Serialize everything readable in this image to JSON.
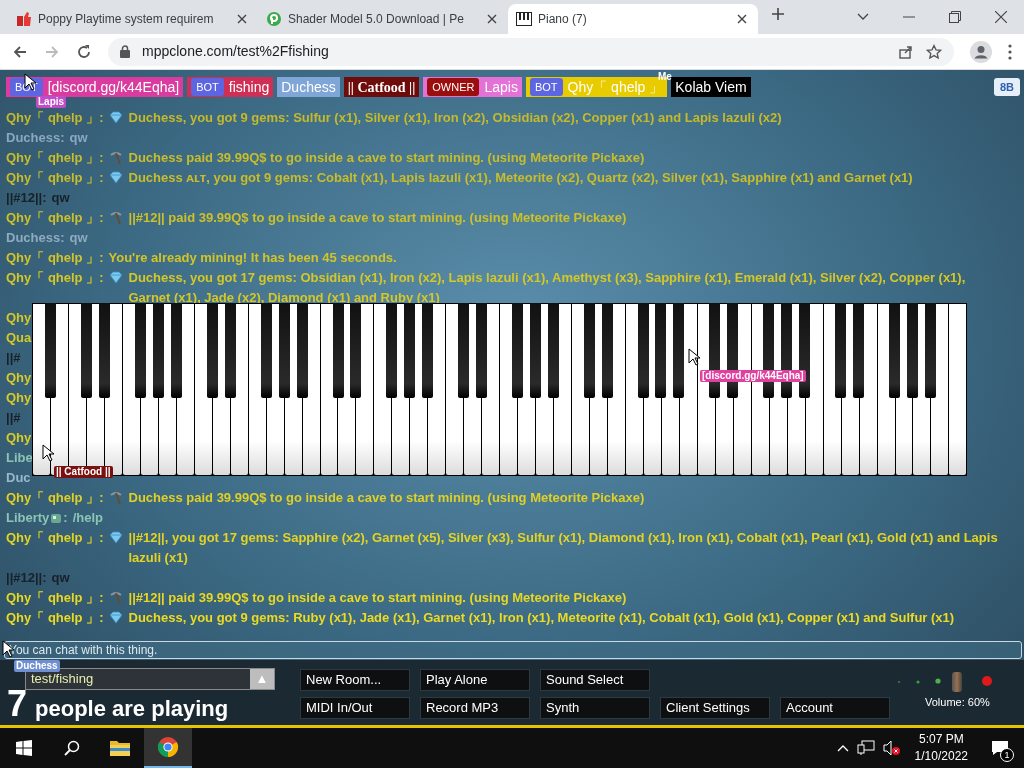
{
  "browser": {
    "tabs": [
      {
        "title": "Poppy Playtime system requirem",
        "selected": false
      },
      {
        "title": "Shader Model 5.0 Download | Pe",
        "selected": false
      },
      {
        "title": "Piano (7)",
        "selected": true
      }
    ],
    "address": "mppclone.com/test%2Ffishing"
  },
  "participants": [
    {
      "kind": "bot",
      "tag": "BOT",
      "name": "[discord.gg/k44Eqha]",
      "color": "#d93c9e"
    },
    {
      "kind": "bot",
      "tag": "BOT",
      "name": "fishing",
      "color": "#cf2f55"
    },
    {
      "kind": "plain",
      "name": "Duchess",
      "color": "#7fa6d6"
    },
    {
      "kind": "fancy",
      "name": "|| Catfood ||",
      "color": "#6e0c0c"
    },
    {
      "kind": "owner",
      "tag": "OWNER",
      "name": "Lapis",
      "color": "#e472d6"
    },
    {
      "kind": "bot",
      "tag": "BOT",
      "name": "Qhy「 qhelp 」",
      "color": "#e9cc00"
    },
    {
      "kind": "plain",
      "name": "Kolab Viem",
      "color": "#000000"
    }
  ],
  "corner_button": "8B",
  "cursors": [
    {
      "name": "Lapis",
      "color": "#c04cc8",
      "arrow": true
    },
    {
      "name": "Me",
      "arrow": false
    },
    {
      "name": "[discord.gg/k44Eqha]",
      "color": "#e040a0",
      "arrow": true
    },
    {
      "name": "|| Catfood ||",
      "color": "#7a1010",
      "arrow": true
    },
    {
      "name": "Duchess",
      "color": "#6f8fd0",
      "arrow": true
    }
  ],
  "chat": [
    {
      "kind": "gem",
      "name": "Qhy「 qhelp 」:",
      "color": "#c4ba2a",
      "text": "Duchess, you got 9 gems: Sulfur (x1), Silver (x1), Iron (x2), Obsidian (x2), Copper (x1) and Lapis lazuli (x2)"
    },
    {
      "kind": "plain",
      "name": "Duchess:",
      "color": "#8aa8be",
      "text": "qw"
    },
    {
      "kind": "pickaxe",
      "name": "Qhy「 qhelp 」:",
      "color": "#c8bd2a",
      "text": "Duchess paid 39.99Q$ to go inside a cave to start mining. (using Meteorite Pickaxe)"
    },
    {
      "kind": "gem",
      "name": "Qhy「 qhelp 」:",
      "color": "#c8bd2a",
      "text": "Duchess ᴀʟᴛ, you got 9 gems: Cobalt (x1), Lapis lazuli (x1), Meteorite (x2), Quartz (x2), Silver (x1), Sapphire (x1) and Garnet (x1)"
    },
    {
      "kind": "plain",
      "name": "||#12||:",
      "color": "#16212a",
      "text": "qw"
    },
    {
      "kind": "pickaxe",
      "name": "Qhy「 qhelp 」:",
      "color": "#cdc128",
      "text": "||#12|| paid 39.99Q$ to go inside a cave to start mining. (using Meteorite Pickaxe)"
    },
    {
      "kind": "plain",
      "name": "Duchess:",
      "color": "#8fabc0",
      "text": "qw"
    },
    {
      "kind": "plain",
      "name": "Qhy「 qhelp 」:",
      "color": "#d2c527",
      "text": "You're already mining! It has been 45 seconds."
    },
    {
      "kind": "gem",
      "name": "Qhy「 qhelp 」:",
      "color": "#d5c826",
      "text": "Duchess, you got 17 gems: Obsidian (x1), Iron (x2), Lapis lazuli (x1), Amethyst (x3), Sapphire (x1), Emerald (x1), Silver (x2), Copper (x1), Garnet (x1), Jade (x2), Diamond (x1) and Ruby (x1)"
    },
    {
      "kind": "plain",
      "name": "Qhy",
      "color": "#d6c925"
    },
    {
      "kind": "plain",
      "text": "Qua",
      "color": "#d6c925"
    },
    {
      "kind": "plain",
      "name": "||#",
      "color": "#16212a"
    },
    {
      "kind": "plain",
      "name": "Qhy",
      "color": "#d8cb25"
    },
    {
      "kind": "plain",
      "name": "Qhy",
      "color": "#d8cb25"
    },
    {
      "kind": "plain",
      "name": "||#",
      "color": "#16212a"
    },
    {
      "kind": "plain",
      "name": "Qhy",
      "color": "#dacd24"
    },
    {
      "kind": "plain",
      "name": "Libe",
      "color": "#8cc4b6"
    },
    {
      "kind": "plain",
      "name": "Duc",
      "color": "#98b8cc"
    },
    {
      "kind": "pickaxe",
      "name": "Qhy「 qhelp 」:",
      "color": "#e0d024",
      "text": "Duchess paid 39.99Q$ to go inside a cave to start mining. (using Meteorite Pickaxe)"
    },
    {
      "kind": "plain",
      "name": "Liberty",
      "color": "#8cc4b6",
      "name_icon": true,
      "colon": ":",
      "text": "/help"
    },
    {
      "kind": "gem",
      "name": "Qhy「 qhelp 」:",
      "color": "#e4d422",
      "text": "||#12||, you got 17 gems: Sapphire (x2), Garnet (x5), Silver (x3), Sulfur (x1), Diamond (x1), Iron (x1), Cobalt (x1), Pearl (x1), Gold (x1) and Lapis lazuli (x1)"
    },
    {
      "kind": "plain",
      "name": "||#12||:",
      "color": "#16212a",
      "text": "qw"
    },
    {
      "kind": "pickaxe",
      "name": "Qhy「 qhelp 」:",
      "color": "#e8d822",
      "text": "||#12|| paid 39.99Q$ to go inside a cave to start mining. (using Meteorite Pickaxe)"
    },
    {
      "kind": "gem",
      "name": "Qhy「 qhelp 」:",
      "color": "#ecdb20",
      "text": "Duchess, you got 9 gems: Ruby (x1), Jade (x1), Garnet (x1), Iron (x1), Meteorite (x1), Cobalt (x1), Gold (x1), Copper (x1) and Sulfur (x1)"
    }
  ],
  "chat_input": {
    "placeholder": "You can chat with this thing."
  },
  "room": {
    "value": "test/fishing",
    "toggle": "▲"
  },
  "count": {
    "number": "7",
    "label": "people are playing"
  },
  "buttons": [
    [
      "New Room...",
      "Play Alone",
      "Sound Select"
    ],
    [
      "MIDI In/Out",
      "Record MP3",
      "Synth",
      "Client Settings",
      "Account"
    ]
  ],
  "volume": {
    "reading": "Volume: 60%"
  },
  "taskbar": {
    "time": "5:07 PM",
    "date": "1/10/2022",
    "notifications": "1"
  }
}
